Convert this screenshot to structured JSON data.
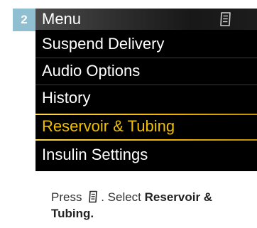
{
  "step": {
    "number": "2"
  },
  "screen": {
    "header": {
      "title": "Menu",
      "icon": "menu-icon"
    },
    "items": [
      {
        "label": "Suspend Delivery",
        "selected": false
      },
      {
        "label": "Audio Options",
        "selected": false
      },
      {
        "label": "History",
        "selected": false
      },
      {
        "label": "Reservoir & Tubing",
        "selected": true
      },
      {
        "label": "Insulin Settings",
        "selected": false
      }
    ],
    "selected_color": "#f0c000",
    "background_color": "#000000"
  },
  "instruction": {
    "prefix": "Press",
    "icon": "menu-icon",
    "middle": ". Select",
    "bold": "Reservoir & Tubing."
  },
  "colors": {
    "badge": "#8fbfd0",
    "accent_gold": "#f0b400"
  }
}
